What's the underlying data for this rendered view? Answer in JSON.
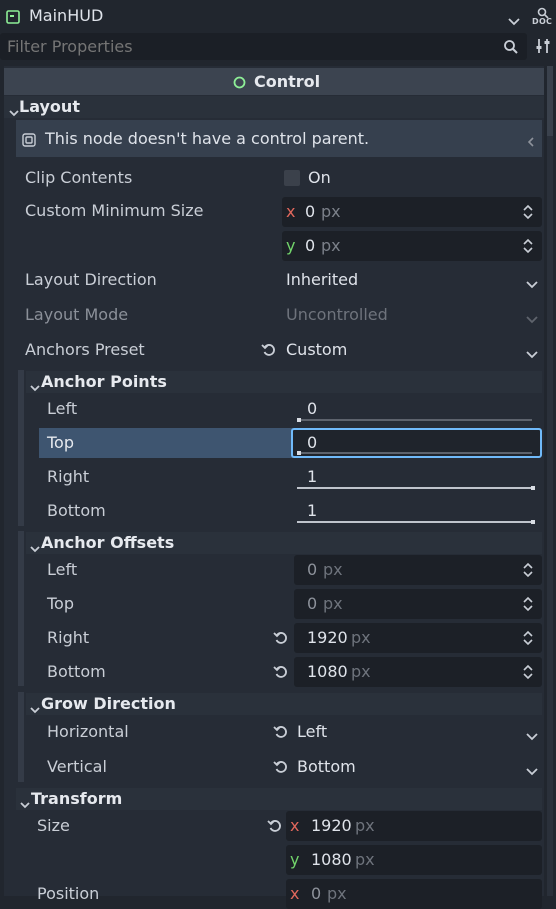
{
  "header": {
    "node_name": "MainHUD",
    "doc_label": "DOC"
  },
  "filter": {
    "placeholder": "Filter Properties"
  },
  "category": {
    "title": "Control"
  },
  "layout": {
    "title": "Layout",
    "warning": "This node doesn't have a control parent.",
    "clip_contents": {
      "label": "Clip Contents",
      "value": "On"
    },
    "custom_min_size": {
      "label": "Custom Minimum Size",
      "x": "0",
      "y": "0",
      "unit": "px"
    },
    "layout_direction": {
      "label": "Layout Direction",
      "value": "Inherited"
    },
    "layout_mode": {
      "label": "Layout Mode",
      "value": "Uncontrolled"
    },
    "anchors_preset": {
      "label": "Anchors Preset",
      "value": "Custom"
    }
  },
  "anchor_points": {
    "title": "Anchor Points",
    "left": {
      "label": "Left",
      "value": "0"
    },
    "top": {
      "label": "Top",
      "value": "0"
    },
    "right": {
      "label": "Right",
      "value": "1"
    },
    "bottom": {
      "label": "Bottom",
      "value": "1"
    }
  },
  "anchor_offsets": {
    "title": "Anchor Offsets",
    "unit": "px",
    "left": {
      "label": "Left",
      "value": "0"
    },
    "top": {
      "label": "Top",
      "value": "0"
    },
    "right": {
      "label": "Right",
      "value": "1920"
    },
    "bottom": {
      "label": "Bottom",
      "value": "1080"
    }
  },
  "grow_direction": {
    "title": "Grow Direction",
    "horizontal": {
      "label": "Horizontal",
      "value": "Left"
    },
    "vertical": {
      "label": "Vertical",
      "value": "Bottom"
    }
  },
  "transform": {
    "title": "Transform",
    "size": {
      "label": "Size",
      "x": "1920",
      "y": "1080",
      "unit": "px"
    },
    "position": {
      "label": "Position",
      "x": "0",
      "unit": "px"
    }
  },
  "axis": {
    "x": "x",
    "y": "y"
  },
  "colors": {
    "accent": "#70bafa",
    "axis_x": "#e0675c",
    "axis_y": "#72d46b",
    "ok_circle": "#8eef97"
  }
}
